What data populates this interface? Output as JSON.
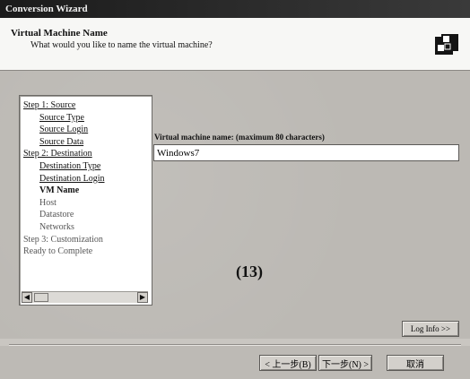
{
  "window": {
    "title": "Conversion Wizard"
  },
  "header": {
    "title": "Virtual Machine Name",
    "subtitle": "What would you like to name the virtual machine?",
    "logo_icon": "vmware-converter-logo-icon"
  },
  "steps": [
    {
      "label": "Step 1: Source",
      "level": 0,
      "state": "link"
    },
    {
      "label": "Source Type",
      "level": 1,
      "state": "link"
    },
    {
      "label": "Source Login",
      "level": 1,
      "state": "link"
    },
    {
      "label": "Source Data",
      "level": 1,
      "state": "link"
    },
    {
      "label": "Step 2: Destination",
      "level": 0,
      "state": "link"
    },
    {
      "label": "Destination Type",
      "level": 1,
      "state": "link"
    },
    {
      "label": "Destination Login",
      "level": 1,
      "state": "link"
    },
    {
      "label": "VM Name",
      "level": 1,
      "state": "current"
    },
    {
      "label": "Host",
      "level": 1,
      "state": "dim"
    },
    {
      "label": "Datastore",
      "level": 1,
      "state": "dim"
    },
    {
      "label": "Networks",
      "level": 1,
      "state": "dim"
    },
    {
      "label": "Step 3: Customization",
      "level": 0,
      "state": "dim"
    },
    {
      "label": "Ready to Complete",
      "level": 0,
      "state": "dim"
    }
  ],
  "form": {
    "label": "Virtual machine name: (maximum 80 characters)",
    "value": "Windows7"
  },
  "annotation": {
    "text": "(13)"
  },
  "buttons": {
    "log_info": "Log Info >>",
    "back": "< 上一步(B)",
    "next": "下一步(N) >",
    "cancel": "取消"
  }
}
